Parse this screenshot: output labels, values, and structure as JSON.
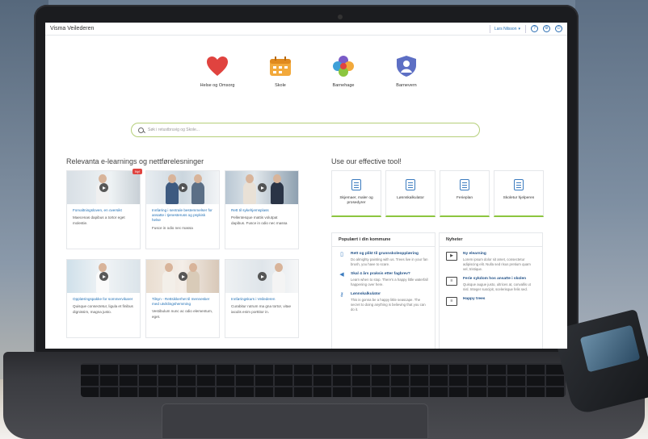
{
  "app": {
    "title": "Visma Veilederen",
    "user_label": "Lars Nilsson",
    "help_icon": "question-icon",
    "settings_icon": "gear-icon",
    "power_icon": "power-icon"
  },
  "categories": [
    {
      "label": "Helse og Omsorg",
      "icon": "heart-icon",
      "color": "#e0433f"
    },
    {
      "label": "Skole",
      "icon": "school-icon",
      "color": "#f2a93b"
    },
    {
      "label": "Barnehage",
      "icon": "flower-icon",
      "color": "#7a5bc7"
    },
    {
      "label": "Barnevern",
      "icon": "shield-icon",
      "color": "#5d6fc4"
    }
  ],
  "search": {
    "placeholder": "Søk i retustbruvig og Skole..."
  },
  "elearning": {
    "title": "Relevanta e-learnings og nettførelesninger",
    "cards": [
      {
        "title": "Forvaltningsloven, en oversikt",
        "desc": "Maecenas dapibus a tortor eget molestie.",
        "badge": "Ny!"
      },
      {
        "title": "Innføring i sentrale bestemmelser for ansatte i tjenesteruss og psykisk helse",
        "desc": "Fusce in odio nec massa",
        "badge": ""
      },
      {
        "title": "Rett til sykehjemsplass",
        "desc": "Pellentesque mattis volutpat dapibus. Fusce in odio nec massa",
        "badge": ""
      },
      {
        "title": "Opplæringspakke for sommervikarer",
        "desc": "Quisque consectetur, ligula et finibus dignissim, magna justo.",
        "badge": ""
      },
      {
        "title": "Tilsyn - Rettsikkerhet til mennesker med utviklingshemming",
        "desc": "Vestibulum nunc ac odio elementum, eget.",
        "badge": ""
      },
      {
        "title": "Innføringskurs i Veilederen",
        "desc": "Curabitur rutrum ma gna tortor, vitae iaculis enim porttitor in.",
        "badge": ""
      }
    ]
  },
  "tools": {
    "title": "Use our effective tool!",
    "items": [
      {
        "label": "Skjemaer, maler og prosedyrer"
      },
      {
        "label": "Lønnskalkulator"
      },
      {
        "label": "Ferieplan"
      },
      {
        "label": "Skoletur hjelperen"
      }
    ]
  },
  "popular": {
    "title": "Populært i din kommune",
    "items": [
      {
        "title": "Rett og plikt til grunnskoleopplæring",
        "desc": "Do almighty painting with us. Trees live in your fan brush, you have to scare."
      },
      {
        "title": "Skal 4 års praksis etter fagbrev?",
        "desc": "Learn when to stop. There's a happy little waterfall happening over here."
      },
      {
        "title": "Lønnskalkulator",
        "desc": "This is gonna be a happy little seascape. The secret to doing anything is believing that you can do it."
      }
    ]
  },
  "news": {
    "title": "Nyheter",
    "items": [
      {
        "title": "Ny elearning",
        "desc": "Lorem ipsum dolor sit amet, consectetur adipiscing elit. Nulla sed risus pretium quam vel, tristique."
      },
      {
        "title": "Ferie sykdom hos ansatte i skolen",
        "desc": "Quisque augue justo, ultrices at, convallis ut nisl. Integer suscipit, scelerisque felis sed."
      },
      {
        "title": "Happy trees",
        "desc": ""
      }
    ]
  }
}
